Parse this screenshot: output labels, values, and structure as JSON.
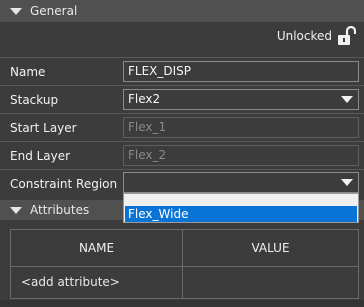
{
  "general": {
    "title": "General"
  },
  "lock": {
    "label": "Unlocked",
    "icon": "unlocked-padlock-icon"
  },
  "properties": {
    "name": {
      "label": "Name",
      "value": "FLEX_DISP"
    },
    "stackup": {
      "label": "Stackup",
      "value": "Flex2"
    },
    "start_layer": {
      "label": "Start Layer",
      "value": "Flex_1"
    },
    "end_layer": {
      "label": "End Layer",
      "value": "Flex_2"
    },
    "constraint_region": {
      "label": "Constraint Region",
      "value": ""
    }
  },
  "constraint_region_popup": {
    "options": [
      "Flex_Wide"
    ]
  },
  "attributes": {
    "title": "Attributes",
    "columns": [
      "NAME",
      "VALUE"
    ],
    "rows": [
      {
        "name": "<add attribute>",
        "value": ""
      }
    ]
  },
  "colors": {
    "background": "#3c3c3c",
    "header": "#505050",
    "selection": "#0a74d6"
  }
}
